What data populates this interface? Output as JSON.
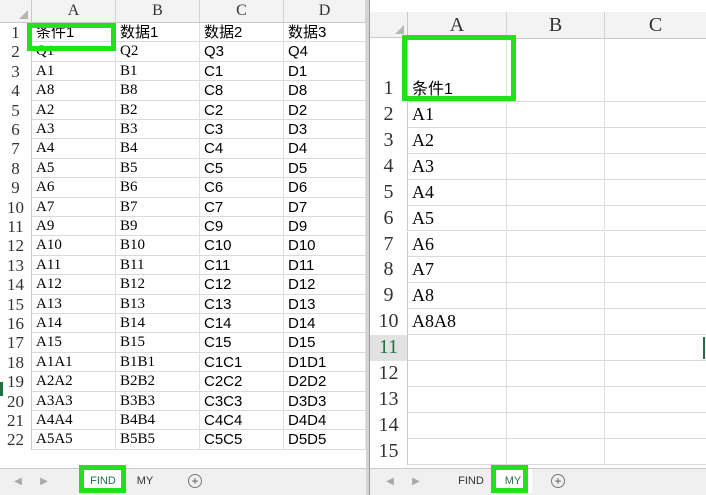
{
  "left_sheet": {
    "columns": [
      "A",
      "B",
      "C",
      "D"
    ],
    "rows": [
      {
        "n": "1",
        "cells": [
          "条件1",
          "数据1",
          "数据2",
          "数据3"
        ]
      },
      {
        "n": "2",
        "cells": [
          "Q1",
          "Q2",
          "Q3",
          "Q4"
        ]
      },
      {
        "n": "3",
        "cells": [
          "A1",
          "B1",
          "C1",
          "D1"
        ]
      },
      {
        "n": "4",
        "cells": [
          "A8",
          "B8",
          "C8",
          "D8"
        ]
      },
      {
        "n": "5",
        "cells": [
          "A2",
          "B2",
          "C2",
          "D2"
        ]
      },
      {
        "n": "6",
        "cells": [
          "A3",
          "B3",
          "C3",
          "D3"
        ]
      },
      {
        "n": "7",
        "cells": [
          "A4",
          "B4",
          "C4",
          "D4"
        ]
      },
      {
        "n": "8",
        "cells": [
          "A5",
          "B5",
          "C5",
          "D5"
        ]
      },
      {
        "n": "9",
        "cells": [
          "A6",
          "B6",
          "C6",
          "D6"
        ]
      },
      {
        "n": "10",
        "cells": [
          "A7",
          "B7",
          "C7",
          "D7"
        ]
      },
      {
        "n": "11",
        "cells": [
          "A9",
          "B9",
          "C9",
          "D9"
        ]
      },
      {
        "n": "12",
        "cells": [
          "A10",
          "B10",
          "C10",
          "D10"
        ]
      },
      {
        "n": "13",
        "cells": [
          "A11",
          "B11",
          "C11",
          "D11"
        ]
      },
      {
        "n": "14",
        "cells": [
          "A12",
          "B12",
          "C12",
          "D12"
        ]
      },
      {
        "n": "15",
        "cells": [
          "A13",
          "B13",
          "C13",
          "D13"
        ]
      },
      {
        "n": "16",
        "cells": [
          "A14",
          "B14",
          "C14",
          "D14"
        ]
      },
      {
        "n": "17",
        "cells": [
          "A15",
          "B15",
          "C15",
          "D15"
        ]
      },
      {
        "n": "18",
        "cells": [
          "A1A1",
          "B1B1",
          "C1C1",
          "D1D1"
        ]
      },
      {
        "n": "19",
        "cells": [
          "A2A2",
          "B2B2",
          "C2C2",
          "D2D2"
        ]
      },
      {
        "n": "20",
        "cells": [
          "A3A3",
          "B3B3",
          "C3C3",
          "D3D3"
        ]
      },
      {
        "n": "21",
        "cells": [
          "A4A4",
          "B4B4",
          "C4C4",
          "D4D4"
        ]
      },
      {
        "n": "22",
        "cells": [
          "A5A5",
          "B5B5",
          "C5C5",
          "D5D5"
        ]
      }
    ],
    "tabs": [
      "FIND",
      "MY"
    ],
    "active_tab": "FIND"
  },
  "right_sheet": {
    "columns": [
      "A",
      "B",
      "C"
    ],
    "rows": [
      {
        "n": "1",
        "cells": [
          "条件1",
          "",
          ""
        ]
      },
      {
        "n": "2",
        "cells": [
          "A1",
          "",
          ""
        ]
      },
      {
        "n": "3",
        "cells": [
          "A2",
          "",
          ""
        ]
      },
      {
        "n": "4",
        "cells": [
          "A3",
          "",
          ""
        ]
      },
      {
        "n": "5",
        "cells": [
          "A4",
          "",
          ""
        ]
      },
      {
        "n": "6",
        "cells": [
          "A5",
          "",
          ""
        ]
      },
      {
        "n": "7",
        "cells": [
          "A6",
          "",
          ""
        ]
      },
      {
        "n": "8",
        "cells": [
          "A7",
          "",
          ""
        ]
      },
      {
        "n": "9",
        "cells": [
          "A8",
          "",
          ""
        ]
      },
      {
        "n": "10",
        "cells": [
          "A8A8",
          "",
          ""
        ]
      },
      {
        "n": "11",
        "cells": [
          "",
          "",
          ""
        ]
      },
      {
        "n": "12",
        "cells": [
          "",
          "",
          ""
        ]
      },
      {
        "n": "13",
        "cells": [
          "",
          "",
          ""
        ]
      },
      {
        "n": "14",
        "cells": [
          "",
          "",
          ""
        ]
      },
      {
        "n": "15",
        "cells": [
          "",
          "",
          ""
        ]
      }
    ],
    "active_row": "11",
    "tabs": [
      "FIND",
      "MY"
    ],
    "active_tab": "MY"
  },
  "icons": {
    "prev_sheet": "chevron-left-icon",
    "next_sheet": "chevron-right-icon",
    "add_sheet": "plus-circle-icon"
  },
  "colors": {
    "highlight": "#22e01a",
    "active_green": "#217346"
  }
}
